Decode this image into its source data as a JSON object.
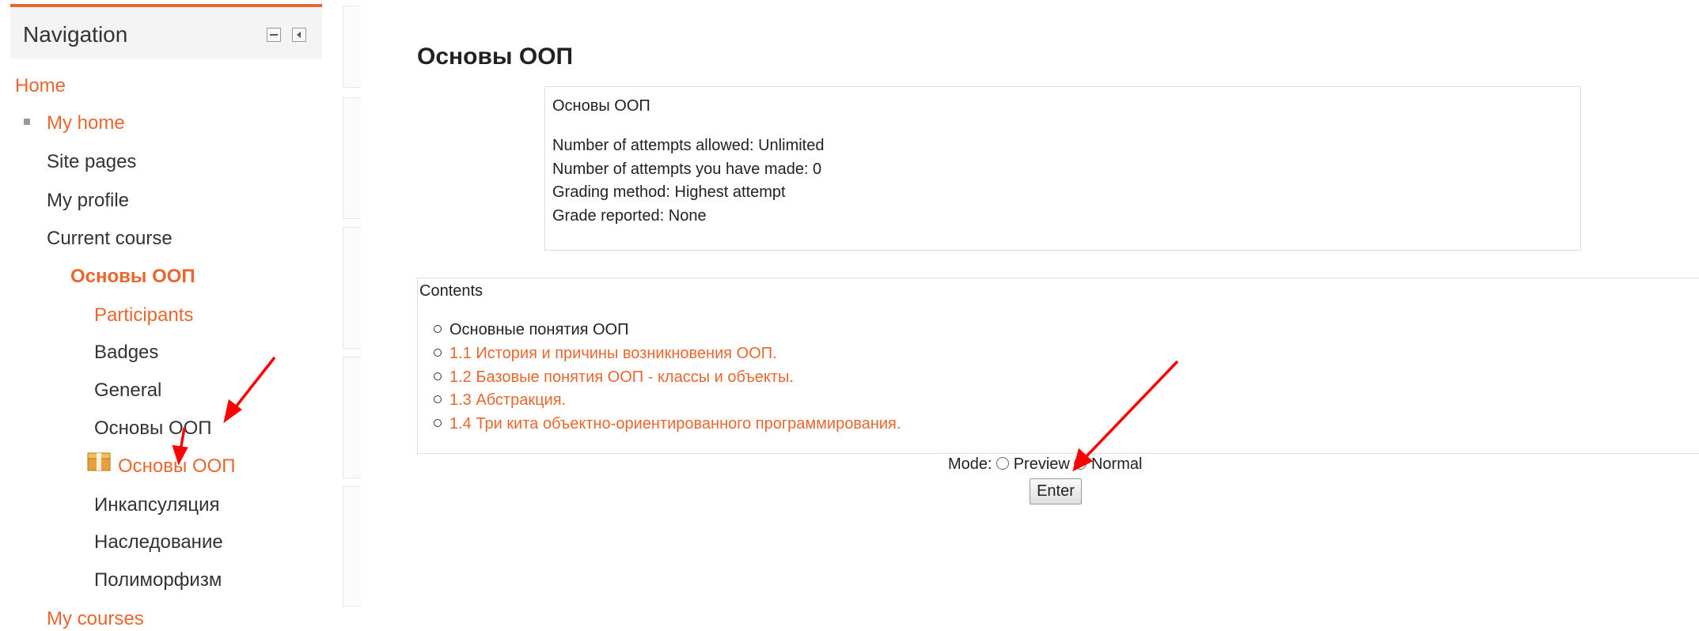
{
  "navigation": {
    "title": "Navigation",
    "home": "Home",
    "my_home": "My home",
    "site_pages": "Site pages",
    "my_profile": "My profile",
    "current_course": "Current course",
    "course_name": "Основы ООП",
    "participants": "Participants",
    "badges": "Badges",
    "general": "General",
    "section_name": "Основы ООП",
    "quiz_name": "Основы ООП",
    "encapsulation": "Инкапсуляция",
    "inheritance": "Наследование",
    "polymorphism": "Полиморфизм",
    "my_courses": "My courses"
  },
  "main": {
    "title": "Основы ООП",
    "info": {
      "heading": "Основы ООП",
      "attempts_allowed": "Number of attempts allowed: Unlimited",
      "attempts_made": "Number of attempts you have made: 0",
      "grading_method": "Grading method: Highest attempt",
      "grade_reported": "Grade reported: None"
    },
    "contents": {
      "label": "Contents",
      "items": [
        "Основные понятия ООП",
        "1.1 История и причины возникновения ООП.",
        "1.2 Базовые понятия ООП - классы и объекты.",
        "1.3 Абстракция.",
        "1.4 Три кита объектно-ориентированного программирования."
      ]
    },
    "mode": {
      "label": "Mode:",
      "preview": "Preview",
      "normal": "Normal",
      "selected": "Normal"
    },
    "enter_label": "Enter"
  },
  "colors": {
    "accent": "#e8672f",
    "arrow": "#ff0000"
  },
  "icons": {
    "collapse": "collapse-block-icon",
    "dock": "dock-block-icon",
    "bullet": "square-bullet-icon",
    "quiz": "scorm-package-icon"
  }
}
